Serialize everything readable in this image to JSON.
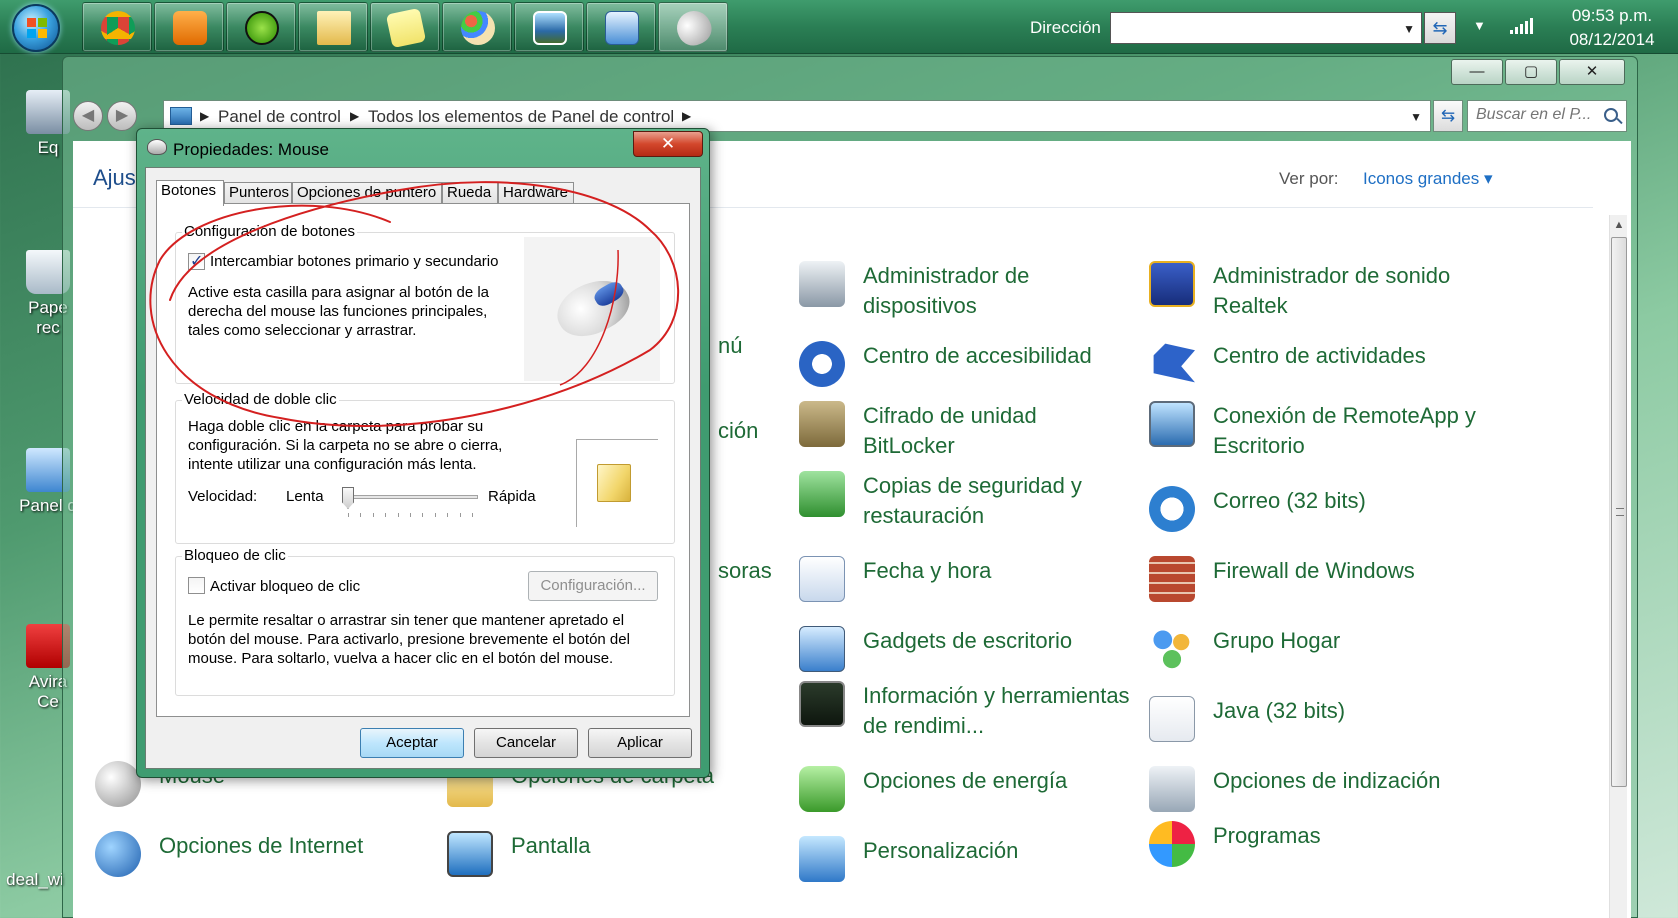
{
  "taskbar": {
    "address_label": "Dirección",
    "address_value": "",
    "clock_time": "09:53 p.m.",
    "clock_date": "08/12/2014",
    "apps": [
      "chrome-icon",
      "media-player-icon",
      "spotify-icon",
      "folder-icon",
      "sticky-notes-icon",
      "paint-icon",
      "photo-viewer-icon",
      "control-panel-icon",
      "mouse-icon"
    ]
  },
  "desktop": {
    "icons": [
      {
        "label": "Eq"
      },
      {
        "label": "Pape rec"
      },
      {
        "label": "Panel d"
      },
      {
        "label": "Avira Ce"
      },
      {
        "label": "deal_wi"
      }
    ]
  },
  "explorer": {
    "window_controls": {
      "minimize": "—",
      "maximize": "▢",
      "close": "✕"
    },
    "breadcrumb": [
      "Panel de control",
      "Todos los elementos de Panel de control"
    ],
    "search_placeholder": "Buscar en el P...",
    "heading_partial": "Ajus",
    "view_by_label": "Ver por:",
    "view_by_value": "Iconos grandes ▾",
    "items": [
      {
        "label": "Administrador de dispositivos",
        "icon": "device-manager-icon"
      },
      {
        "label": "Administrador de sonido Realtek",
        "icon": "realtek-sound-icon"
      },
      {
        "label": "Centro de accesibilidad",
        "icon": "accessibility-icon"
      },
      {
        "label": "Centro de actividades",
        "icon": "action-center-flag-icon"
      },
      {
        "label": "Cifrado de unidad BitLocker",
        "icon": "bitlocker-icon"
      },
      {
        "label": "Conexión de RemoteApp y Escritorio",
        "icon": "remoteapp-icon"
      },
      {
        "label": "Copias de seguridad y restauración",
        "icon": "backup-icon"
      },
      {
        "label": "Correo (32 bits)",
        "icon": "mail-icon"
      },
      {
        "label": "Fecha y hora",
        "icon": "date-time-icon"
      },
      {
        "label": "Firewall de Windows",
        "icon": "firewall-icon"
      },
      {
        "label": "Gadgets de escritorio",
        "icon": "gadgets-icon"
      },
      {
        "label": "Grupo Hogar",
        "icon": "homegroup-icon"
      },
      {
        "label": "Información y herramientas de rendimi...",
        "icon": "performance-icon"
      },
      {
        "label": "Java (32 bits)",
        "icon": "java-icon"
      },
      {
        "label": "Opciones de energía",
        "icon": "power-options-icon"
      },
      {
        "label": "Opciones de indización",
        "icon": "indexing-icon"
      },
      {
        "label": "Personalización",
        "icon": "personalization-icon"
      },
      {
        "label": "Programas",
        "icon": "programs-icon"
      }
    ],
    "left_partials": [
      {
        "label": "Opciones de Internet"
      },
      {
        "label": "Pantalla"
      },
      {
        "label": "Mouse"
      },
      {
        "label": "Opciones de carpeta"
      },
      {
        "label": "nú"
      },
      {
        "label": "ción"
      },
      {
        "label": "soras"
      }
    ]
  },
  "dialog": {
    "title": "Propiedades: Mouse",
    "close": "✕",
    "tabs": [
      "Botones",
      "Punteros",
      "Opciones de puntero",
      "Rueda",
      "Hardware"
    ],
    "buttons_group": {
      "label": "Configuración de botones",
      "checkbox_label": "Intercambiar botones primario y secundario",
      "checked": true,
      "description": [
        "Active esta casilla para asignar al botón de la",
        "derecha del mouse las funciones principales,",
        "tales como seleccionar y arrastrar."
      ]
    },
    "doubleclick_group": {
      "label": "Velocidad de doble clic",
      "description": [
        "Haga doble clic en la carpeta para probar su",
        "configuración. Si la carpeta no se abre o cierra,",
        "intente utilizar una configuración más lenta."
      ],
      "speed_label": "Velocidad:",
      "slow": "Lenta",
      "fast": "Rápida",
      "speed_value_fraction": 0.0
    },
    "clicklock_group": {
      "label": "Bloqueo de clic",
      "checkbox_label": "Activar bloqueo de clic",
      "checked": false,
      "config_button": "Configuración...",
      "description": [
        "Le permite resaltar o arrastrar sin tener que mantener apretado el",
        "botón del mouse. Para activarlo, presione brevemente el botón del",
        "mouse. Para soltarlo, vuelva a hacer clic en el botón del mouse."
      ]
    },
    "footer": {
      "ok": "Aceptar",
      "cancel": "Cancelar",
      "apply": "Aplicar"
    }
  },
  "colors": {
    "accent_link": "#1e6fc4",
    "cp_label": "#1e6a36",
    "taskbar": "#2b7f55",
    "annotation": "#d42020"
  }
}
